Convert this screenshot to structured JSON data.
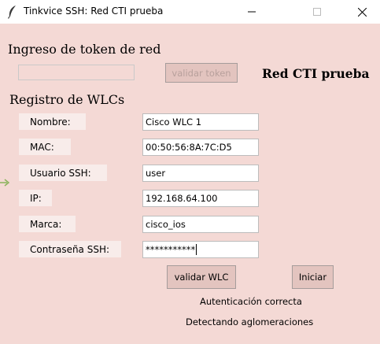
{
  "window": {
    "title": "Tinkvice SSH: Red CTI prueba"
  },
  "token_section": {
    "heading": "Ingreso de token de red",
    "token_value": "",
    "validate_label": "validar token",
    "network_label": "Red CTI prueba"
  },
  "wlc_section": {
    "heading": "Registro de WLCs",
    "fields": [
      {
        "label": "Nombre:",
        "value": "Cisco WLC 1"
      },
      {
        "label": "MAC:",
        "value": "00:50:56:8A:7C:D5"
      },
      {
        "label": "Usuario SSH:",
        "value": "user"
      },
      {
        "label": "IP:",
        "value": "192.168.64.100"
      },
      {
        "label": "Marca:",
        "value": "cisco_ios"
      },
      {
        "label": "Contraseña SSH:",
        "value": "***********"
      }
    ],
    "validate_wlc_label": "validar WLC",
    "start_label": "Iniciar"
  },
  "status": {
    "auth": "Autenticación correcta",
    "detect": "Detectando aglomeraciones"
  },
  "colors": {
    "background": "#f4d9d5",
    "button": "#e3c4bf",
    "label_bg": "#f8ecea",
    "arrow": "#8bb35c"
  },
  "icons": {
    "app": "feather-icon",
    "minimize": "minimize-icon",
    "maximize": "maximize-icon",
    "close": "close-icon"
  }
}
